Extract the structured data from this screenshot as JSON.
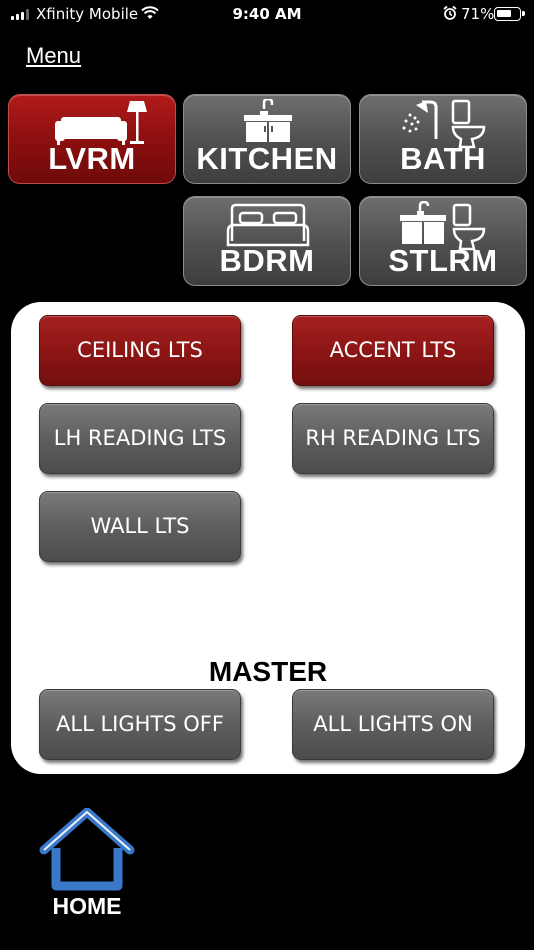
{
  "status_bar": {
    "carrier": "Xfinity Mobile",
    "time": "9:40 AM",
    "battery_percent": "71%",
    "battery_level": 0.71,
    "icons": [
      "signal-icon",
      "wifi-icon",
      "alarm-icon",
      "battery-icon"
    ]
  },
  "menu": {
    "label": "Menu"
  },
  "rooms": [
    {
      "label": "LVRM",
      "icon": "sofa-lamp-icon",
      "active": true
    },
    {
      "label": "KITCHEN",
      "icon": "sink-icon",
      "active": false
    },
    {
      "label": "BATH",
      "icon": "shower-toilet-icon",
      "active": false
    },
    {
      "label": "BDRM",
      "icon": "bed-icon",
      "active": false
    },
    {
      "label": "STLRM",
      "icon": "vanity-toilet-icon",
      "active": false
    }
  ],
  "lights": [
    {
      "label": "CEILING LTS",
      "state": "on"
    },
    {
      "label": "ACCENT LTS",
      "state": "on"
    },
    {
      "label": "LH READING LTS",
      "state": "off"
    },
    {
      "label": "RH READING LTS",
      "state": "off"
    },
    {
      "label": "WALL LTS",
      "state": "off"
    }
  ],
  "master": {
    "title": "MASTER",
    "off_label": "ALL LIGHTS OFF",
    "on_label": "ALL LIGHTS ON"
  },
  "home": {
    "label": "HOME",
    "icon": "home-icon"
  },
  "colors": {
    "active_room": "#8a0f0f",
    "active_light": "#8b1414",
    "inactive_button": "#5c5c5c",
    "home_icon": "#3a78c9",
    "panel": "#ffffff",
    "background": "#000000"
  }
}
